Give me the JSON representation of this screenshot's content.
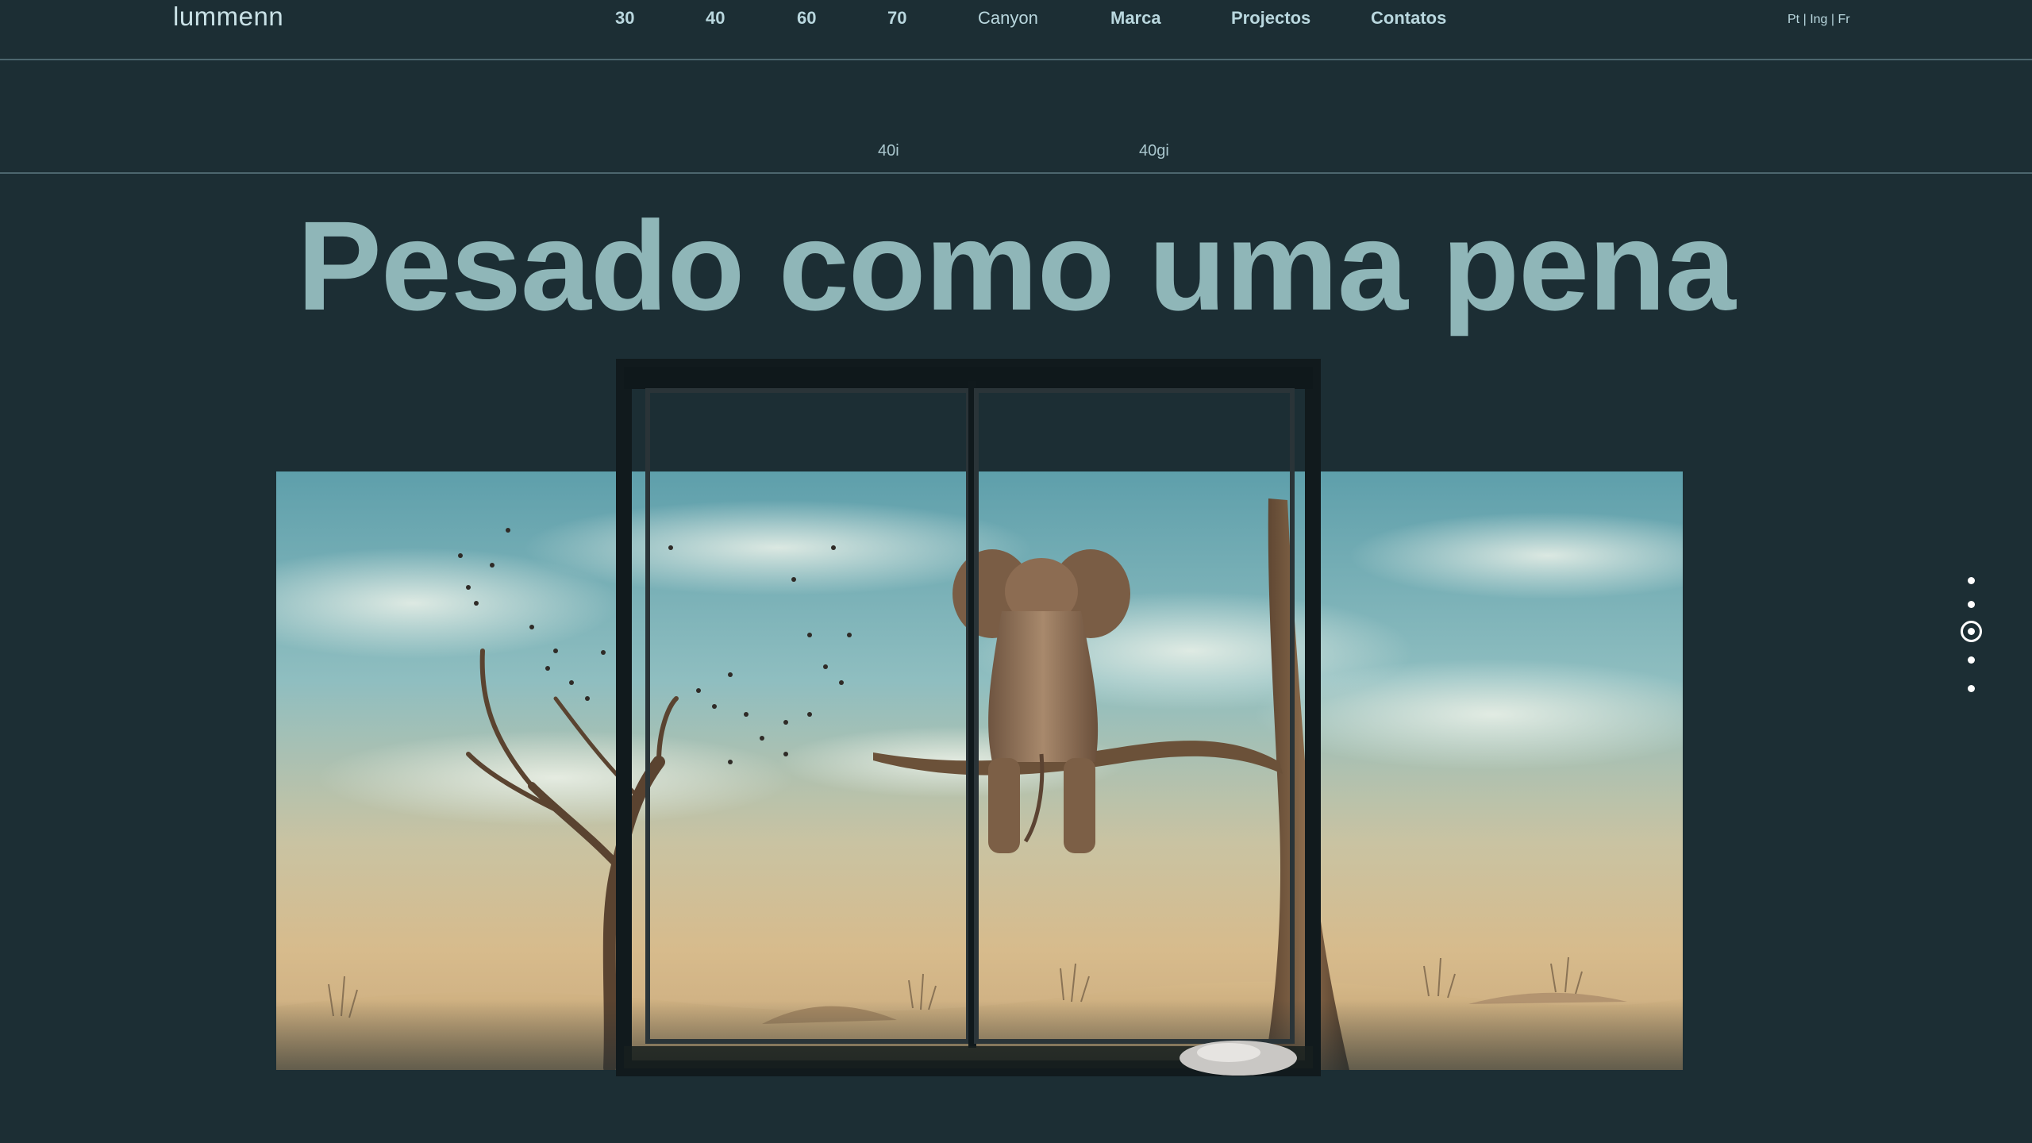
{
  "brand": {
    "logo": "lummenn"
  },
  "nav": {
    "items": [
      {
        "label": "30",
        "weight": "bold"
      },
      {
        "label": "40",
        "weight": "bold"
      },
      {
        "label": "60",
        "weight": "bold"
      },
      {
        "label": "70",
        "weight": "bold"
      },
      {
        "label": "Canyon",
        "weight": "light"
      },
      {
        "label": "Marca",
        "weight": "bold"
      },
      {
        "label": "Projectos",
        "weight": "bold"
      },
      {
        "label": "Contatos",
        "weight": "bold"
      }
    ],
    "languages": [
      "Pt",
      "Ing",
      "Fr"
    ],
    "lang_separator": "|"
  },
  "subnav": {
    "items": [
      "40i",
      "40gi"
    ]
  },
  "hero": {
    "headline": "Pesado como uma pena",
    "image_subject": "elephant sitting on a tree branch behind a sliding window frame in a desert"
  },
  "slider": {
    "total": 5,
    "active_index": 2
  },
  "colors": {
    "background": "#1c2e34",
    "nav_text": "#b9d7de",
    "headline": "#8fb6b8",
    "divider": "#4c666e"
  }
}
